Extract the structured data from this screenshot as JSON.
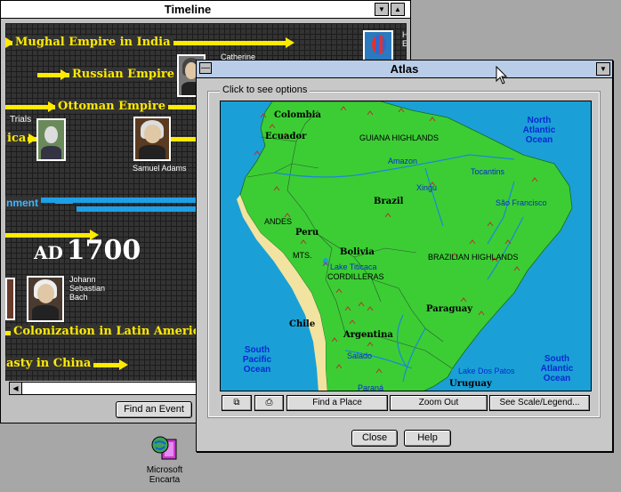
{
  "timeline": {
    "title": "Timeline",
    "events": [
      {
        "label": "Mughal Empire in India"
      },
      {
        "label": "Russian Empire"
      },
      {
        "label": "Ottoman Empire"
      },
      {
        "label": "Trials"
      },
      {
        "label": "ica"
      },
      {
        "label": "nment"
      },
      {
        "label": "Colonization in Latin America"
      },
      {
        "label": "asty in China"
      }
    ],
    "people": [
      {
        "name": "Catherine"
      },
      {
        "name": "Samuel Adams"
      },
      {
        "name_lines": [
          "Johann",
          "Sebastian",
          "Bach"
        ]
      }
    ],
    "year_prefix": "AD",
    "year": "1700",
    "find_event_label": "Find an Event",
    "colors": {
      "event_bar": "#ffea00",
      "blue_event": "#1e9fe6",
      "background": "#333333"
    }
  },
  "atlas": {
    "title": "Atlas",
    "group_label": "Click to see options",
    "map": {
      "countries": [
        "Colombia",
        "Ecuador",
        "Brazil",
        "Peru",
        "Bolivia",
        "Paraguay",
        "Chile",
        "Argentina",
        "Uruguay"
      ],
      "features": [
        "GUIANA HIGHLANDS",
        "ANDES",
        "MTS.",
        "CORDILLERAS",
        "BRAZILIAN HIGHLANDS"
      ],
      "waters": [
        "Amazon",
        "Xingu",
        "Tocantins",
        "São Francisco",
        "Lake Titicaca",
        "Salado",
        "Paraná",
        "Lake Dos Patos"
      ],
      "oceans": {
        "north_atlantic": [
          "North",
          "Atlantic",
          "Ocean"
        ],
        "south_pacific": [
          "South",
          "Pacific",
          "Ocean"
        ],
        "south_atlantic": [
          "South",
          "Atlantic",
          "Ocean"
        ]
      },
      "colors": {
        "water": "#1aa0d6",
        "land": "#3ccd35",
        "coast": "#f2e3a0"
      }
    },
    "toolbar": {
      "copy_icon": "copy-icon",
      "print_icon": "printer-icon",
      "find_place": "Find a Place",
      "zoom_out": "Zoom Out",
      "scale_legend": "See Scale/Legend..."
    },
    "close_label": "Close",
    "help_label": "Help"
  },
  "desktop": {
    "icon_label_line1": "Microsoft",
    "icon_label_line2": "Encarta"
  }
}
